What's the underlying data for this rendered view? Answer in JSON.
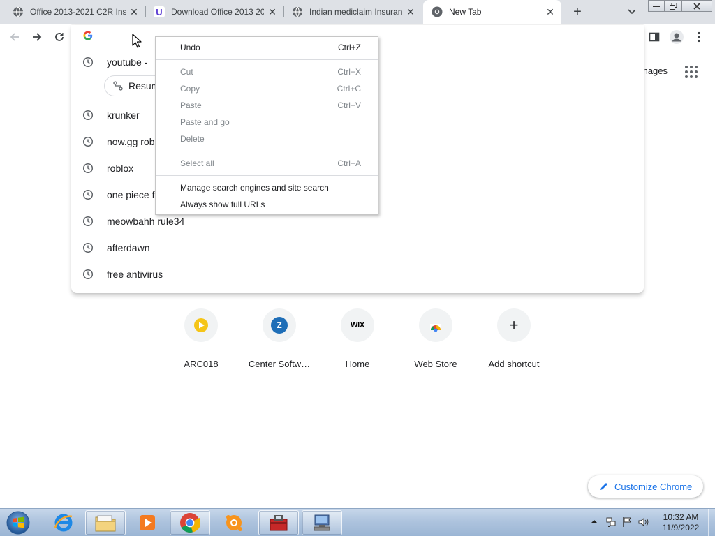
{
  "tabs": [
    {
      "title": "Office 2013-2021 C2R Ins",
      "icon": "globe-icon"
    },
    {
      "title": "Download Office 2013 20",
      "icon": "uptodown-icon"
    },
    {
      "title": "Indian mediclaim Insuranc",
      "icon": "globe-icon"
    },
    {
      "title": "New Tab",
      "icon": "chrome-icon",
      "active": true
    }
  ],
  "tab_close_glyph": "✕",
  "new_tab_glyph": "+",
  "window_controls": {
    "minimize": "▭",
    "maximize": "❐",
    "close": "✕"
  },
  "ntp": {
    "images_link": "mages",
    "shortcuts": [
      {
        "label": "ARC018",
        "icon": "play-icon"
      },
      {
        "label": "Center Softw…",
        "icon": "z-icon",
        "glyph": "Z"
      },
      {
        "label": "Home",
        "icon": "wix-icon",
        "glyph": "WIX"
      },
      {
        "label": "Web Store",
        "icon": "webstore-icon"
      },
      {
        "label": "Add shortcut",
        "icon": "plus-icon",
        "glyph": "+"
      }
    ],
    "customize_label": "Customize Chrome"
  },
  "omnibox": {
    "suggestions": [
      {
        "text": "youtube - "
      },
      {
        "text": "krunker"
      },
      {
        "text": "now.gg rob"
      },
      {
        "text": "roblox"
      },
      {
        "text": "one piece f"
      },
      {
        "text": "meowbahh rule34"
      },
      {
        "text": "afterdawn"
      },
      {
        "text": "free antivirus"
      }
    ],
    "resume_chip": "Resum"
  },
  "context_menu": {
    "items": [
      {
        "label": "Undo",
        "accel": "Ctrl+Z",
        "enabled": true
      },
      {
        "label": "Cut",
        "accel": "Ctrl+X",
        "enabled": false
      },
      {
        "label": "Copy",
        "accel": "Ctrl+C",
        "enabled": false
      },
      {
        "label": "Paste",
        "accel": "Ctrl+V",
        "enabled": false
      },
      {
        "label": "Paste and go",
        "accel": "",
        "enabled": false
      },
      {
        "label": "Delete",
        "accel": "",
        "enabled": false
      },
      {
        "label": "Select all",
        "accel": "Ctrl+A",
        "enabled": false
      },
      {
        "label": "Manage search engines and site search",
        "accel": "",
        "enabled": true
      },
      {
        "label": "Always show full URLs",
        "accel": "",
        "enabled": true
      }
    ]
  },
  "taskbar": {
    "clock_time": "10:32 AM",
    "clock_date": "11/9/2022"
  },
  "colors": {
    "accent": "#1a73e8",
    "tabstrip_bg": "#dee1e6",
    "menu_disabled": "#80868b"
  }
}
